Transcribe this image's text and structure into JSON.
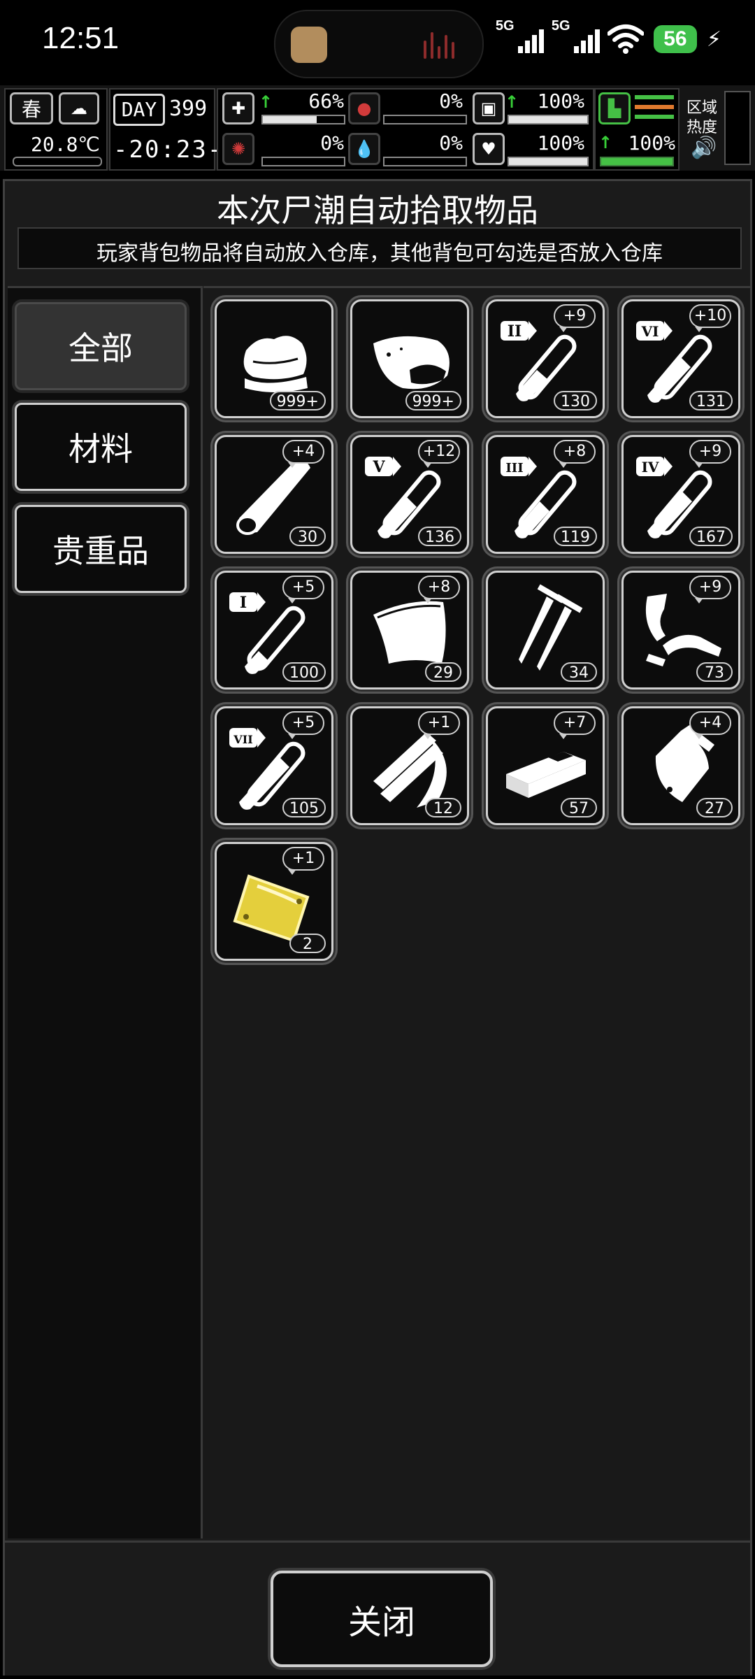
{
  "status_bar": {
    "time": "12:51",
    "network_1": "5G",
    "network_2": "5G",
    "battery": "56"
  },
  "hud": {
    "season": "春",
    "temperature": "20.8℃",
    "day_label": "DAY",
    "day_number": "399",
    "clock": "-20:23-",
    "stats": {
      "health": "66%",
      "hunger": "0%",
      "armor": "100%",
      "infection": "0%",
      "blood": "0%",
      "mood": "100%",
      "stamina": "100%"
    },
    "region_label": "区域",
    "heat_label": "热度"
  },
  "dialog": {
    "title": "本次尸潮自动拾取物品",
    "subtitle": "玩家背包物品将自动放入仓库，其他背包可勾选是否放入仓库",
    "categories": [
      "全部",
      "材料",
      "贵重品"
    ],
    "items": [
      {
        "icon": "cloth-icon",
        "count": "999+",
        "plus": ""
      },
      {
        "icon": "raw-meat-icon",
        "count": "999+",
        "plus": ""
      },
      {
        "icon": "test-tube-II-icon",
        "roman": "II",
        "count": "130",
        "plus": "+9"
      },
      {
        "icon": "test-tube-VI-icon",
        "roman": "VI",
        "count": "131",
        "plus": "+10"
      },
      {
        "icon": "wood-log-icon",
        "count": "30",
        "plus": "+4"
      },
      {
        "icon": "test-tube-V-icon",
        "roman": "V",
        "count": "136",
        "plus": "+12"
      },
      {
        "icon": "test-tube-III-icon",
        "roman": "III",
        "count": "119",
        "plus": "+8"
      },
      {
        "icon": "test-tube-IV-icon",
        "roman": "IV",
        "count": "167",
        "plus": "+9"
      },
      {
        "icon": "test-tube-I-icon",
        "roman": "I",
        "count": "100",
        "plus": "+5"
      },
      {
        "icon": "leather-sheet-icon",
        "count": "29",
        "plus": "+8"
      },
      {
        "icon": "nails-icon",
        "count": "34",
        "plus": ""
      },
      {
        "icon": "scrap-parts-icon",
        "count": "73",
        "plus": "+9"
      },
      {
        "icon": "test-tube-VII-icon",
        "roman": "VII",
        "count": "105",
        "plus": "+5"
      },
      {
        "icon": "wood-planks-icon",
        "count": "12",
        "plus": "+1"
      },
      {
        "icon": "brick-icon",
        "count": "57",
        "plus": "+7"
      },
      {
        "icon": "fabric-roll-icon",
        "count": "27",
        "plus": "+4"
      },
      {
        "icon": "gold-plate-icon",
        "count": "2",
        "plus": "+1"
      }
    ],
    "close_label": "关闭"
  },
  "colors": {
    "accent_green": "#45c045",
    "danger_red": "#d23b3b",
    "gold": "#e4cf3c",
    "battery_green": "#3fc04b"
  }
}
